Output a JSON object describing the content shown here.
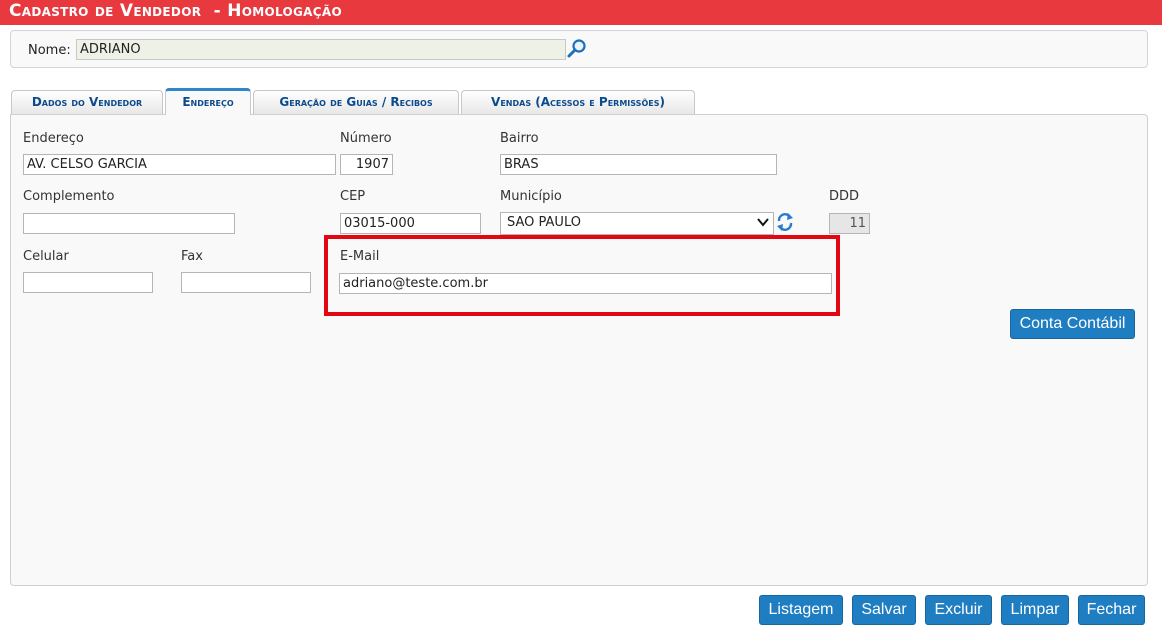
{
  "header": {
    "title": "Cadastro de Vendedor  - Homologação"
  },
  "nome": {
    "label": "Nome:",
    "value": "ADRIANO"
  },
  "tabs": [
    {
      "label": "Dados do Vendedor"
    },
    {
      "label": "Endereço"
    },
    {
      "label": "Geração de Guias / Recibos"
    },
    {
      "label": "Vendas (Acessos e Permissões)"
    }
  ],
  "form": {
    "endereco": {
      "label": "Endereço",
      "value": "AV. CELSO GARCIA"
    },
    "numero": {
      "label": "Número",
      "value": "1907"
    },
    "bairro": {
      "label": "Bairro",
      "value": "BRAS"
    },
    "complemento": {
      "label": "Complemento",
      "value": ""
    },
    "cep": {
      "label": "CEP",
      "value": "03015-000"
    },
    "municipio": {
      "label": "Município",
      "value": "SAO PAULO"
    },
    "ddd": {
      "label": "DDD",
      "value": "11"
    },
    "celular": {
      "label": "Celular",
      "value": ""
    },
    "fax": {
      "label": "Fax",
      "value": ""
    },
    "email": {
      "label": "E-Mail",
      "value": "adriano@teste.com.br"
    }
  },
  "buttons": {
    "conta_contabil": "Conta Contábil",
    "listagem": "Listagem",
    "salvar": "Salvar",
    "excluir": "Excluir",
    "limpar": "Limpar",
    "fechar": "Fechar"
  },
  "colors": {
    "header": "#e8393f",
    "button": "#1f7ec2",
    "highlight": "#e30613",
    "tab_accent": "#2f87c9"
  }
}
